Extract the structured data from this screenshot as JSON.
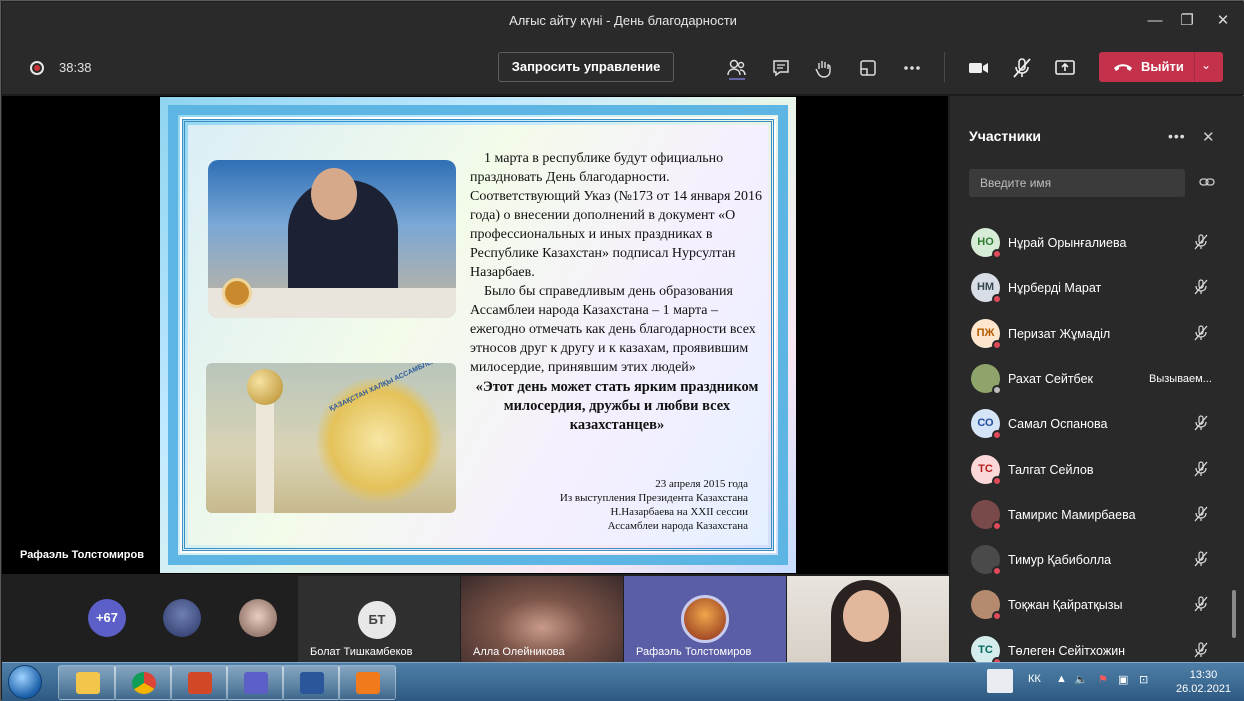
{
  "window": {
    "title": "Алғыс айту күні - День благодарности"
  },
  "toolbar": {
    "timer": "38:38",
    "request_control": "Запросить управление",
    "leave": "Выйти"
  },
  "slide": {
    "paragraphs": [
      "1 марта в республике будут официально праздновать День благодарности. Соответствующий Указ (№173 от 14 января 2016 года) о внесении дополнений в документ «О профессиональных и иных праздниках в Республике Казахстан» подписал Нурсултан Назарбаев.",
      "Было бы справедливым день образования Ассамблеи народа Казахстана – 1 марта – ежегодно отмечать как день благодарности всех этносов друг к другу и к казахам, проявившим милосердие, принявшим этих людей»"
    ],
    "quote": "«Этот день может стать ярким праздником милосердия, дружбы и любви всех казахстанцев»",
    "caption": [
      "23 апреля 2015 года",
      "Из выступления Президента Казахстана",
      "Н.Назарбаева на XXII сессии",
      "Ассамблеи народа Казахстана"
    ],
    "emblem_text": "ҚАЗАҚСТАН ХАЛҚЫ АССАМБЛЕЯСЫ"
  },
  "presenter_name": "Рафаэль Толстомиров",
  "participants": {
    "title": "Участники",
    "search_placeholder": "Введите имя",
    "list": [
      {
        "initials": "НО",
        "name": "Нұрай Орынғалиева",
        "bg": "#d7ecd7",
        "fg": "#2e7d32"
      },
      {
        "initials": "НМ",
        "name": "Нұрберді Марат",
        "bg": "#d9dde6",
        "fg": "#37474f"
      },
      {
        "initials": "ПЖ",
        "name": "Перизат Жұмаділ",
        "bg": "#fde6cc",
        "fg": "#b45a00"
      },
      {
        "initials": "",
        "name": "Рахат Сейтбек",
        "status": "Вызываем...",
        "bg": "#8fa46b",
        "fg": "#fff"
      },
      {
        "initials": "СО",
        "name": "Самал Оспанова",
        "bg": "#d6e4f8",
        "fg": "#1f4e9c"
      },
      {
        "initials": "ТС",
        "name": "Талгат Сейлов",
        "bg": "#fbd7d7",
        "fg": "#b71c1c"
      },
      {
        "initials": "",
        "name": "Тамирис Мамирбаева",
        "bg": "#7a4a4a",
        "fg": "#fff"
      },
      {
        "initials": "",
        "name": "Тимур Қабиболла",
        "bg": "#4a4a4a",
        "fg": "#fff"
      },
      {
        "initials": "",
        "name": "Тоқжан Қайратқызы",
        "bg": "#b58a6e",
        "fg": "#fff"
      },
      {
        "initials": "ТС",
        "name": "Төлеген Сейітхожин",
        "bg": "#d5ecec",
        "fg": "#00695c"
      }
    ]
  },
  "strip": {
    "overflow_count": "+67",
    "tiles": [
      {
        "initials": "БТ",
        "name": "Болат Тишкамбеков"
      },
      {
        "initials": "",
        "name": "Алла Олейникова"
      },
      {
        "initials": "",
        "name": "Рафаэль Толстомиров"
      },
      {
        "initials": "",
        "name": ""
      }
    ]
  },
  "taskbar": {
    "language": "КК",
    "time": "13:30",
    "date": "26.02.2021"
  },
  "colors": {
    "accent": "#5b5fc7",
    "leave": "#c4314b",
    "status_red": "#e04b5b"
  }
}
